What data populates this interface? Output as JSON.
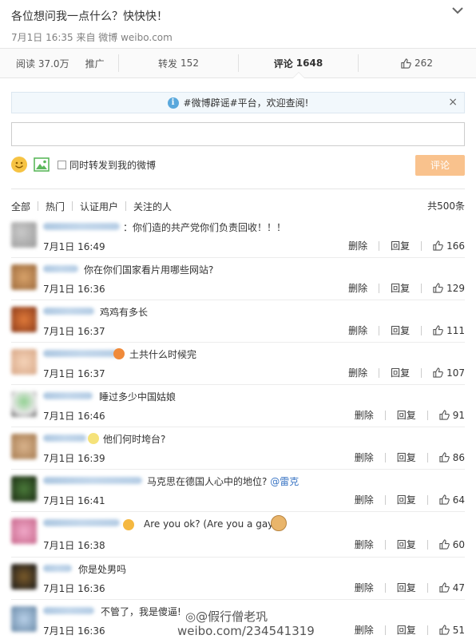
{
  "post": {
    "title": "各位想问我一点什么？快快快！",
    "meta": "7月1日 16:35 来自 微博 weibo.com"
  },
  "stats": {
    "read_label": "阅读",
    "read_count": "37.0万",
    "promote_label": "推广",
    "repost_label": "转发",
    "repost_count": "152",
    "comment_label": "评论",
    "comment_count": "1648",
    "like_count": "262"
  },
  "notice": {
    "text": "#微博辟谣#平台，欢迎查阅!",
    "close": "×"
  },
  "compose": {
    "input_value": "",
    "repost_label": "同时转发到我的微博",
    "submit_label": "评论"
  },
  "filters": {
    "tabs": [
      "全部",
      "热门",
      "认证用户",
      "关注的人"
    ],
    "total": "共500条"
  },
  "actions": {
    "delete_label": "删除",
    "reply_label": "回复"
  },
  "comments": [
    {
      "text": "：你们造的共产党你们负责回收！！！",
      "time": "7月1日 16:49",
      "likes": "166"
    },
    {
      "text": "你在你们国家看片用哪些网站?",
      "time": "7月1日 16:36",
      "likes": "129"
    },
    {
      "text": "鸡鸡有多长",
      "time": "7月1日 16:37",
      "likes": "111"
    },
    {
      "text": "土共什么时候完",
      "time": "7月1日 16:37",
      "likes": "107"
    },
    {
      "text": "睡过多少中国姑娘",
      "time": "7月1日 16:46",
      "likes": "91"
    },
    {
      "text": "他们何时垮台?",
      "time": "7月1日 16:39",
      "likes": "86"
    },
    {
      "text": "马克思在德国人心中的地位?",
      "mention": "@雷克",
      "time": "7月1日 16:41",
      "likes": "64"
    },
    {
      "text": "Are you ok? (Are you a gay?)",
      "time": "7月1日 16:38",
      "likes": "60"
    },
    {
      "text": "你是处男吗",
      "time": "7月1日 16:36",
      "likes": "47"
    },
    {
      "text": "不管了，我是傻逼!",
      "time": "7月1日 16:36",
      "likes": "51"
    }
  ],
  "watermark": {
    "line1": "假行僧老巩",
    "line2": "weibo.com/234541319"
  },
  "colors": {
    "accent": "#f9c28d",
    "link": "#3a75c4",
    "notice_bg": "#f2f8fc"
  }
}
